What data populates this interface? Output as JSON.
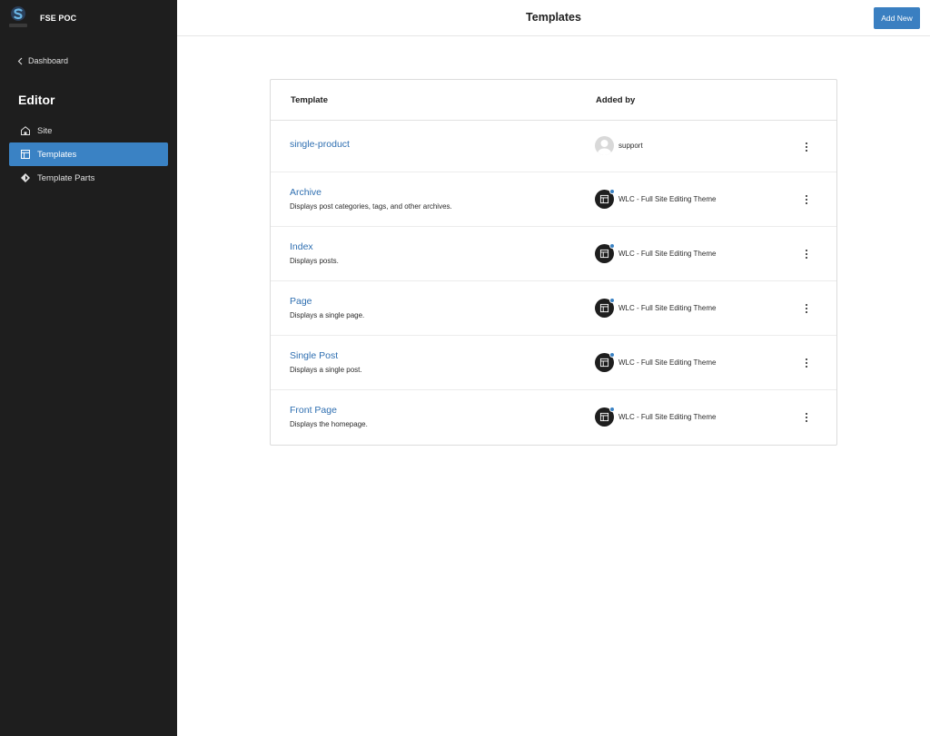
{
  "site": {
    "name": "FSE POC",
    "logo_icon": "site-logo-s-icon"
  },
  "sidebar": {
    "back_label": "Dashboard",
    "editor_title": "Editor",
    "items": [
      {
        "label": "Site",
        "icon": "home-icon",
        "active": false
      },
      {
        "label": "Templates",
        "icon": "layout-icon",
        "active": true
      },
      {
        "label": "Template Parts",
        "icon": "symbol-filled-icon",
        "active": false
      }
    ]
  },
  "header": {
    "title": "Templates",
    "add_new_label": "Add New"
  },
  "table": {
    "columns": {
      "template": "Template",
      "added_by": "Added by"
    },
    "rows": [
      {
        "name": "single-product",
        "description": "",
        "author": "support",
        "author_type": "user"
      },
      {
        "name": "Archive",
        "description": "Displays post categories, tags, and other archives.",
        "author": "WLC - Full Site Editing Theme",
        "author_type": "theme"
      },
      {
        "name": "Index",
        "description": "Displays posts.",
        "author": "WLC - Full Site Editing Theme",
        "author_type": "theme"
      },
      {
        "name": "Page",
        "description": "Displays a single page.",
        "author": "WLC - Full Site Editing Theme",
        "author_type": "theme"
      },
      {
        "name": "Single Post",
        "description": "Displays a single post.",
        "author": "WLC - Full Site Editing Theme",
        "author_type": "theme"
      },
      {
        "name": "Front Page",
        "description": "Displays the homepage.",
        "author": "WLC - Full Site Editing Theme",
        "author_type": "theme"
      }
    ]
  },
  "colors": {
    "sidebar_bg": "#1e1e1e",
    "accent": "#3a82c4",
    "link": "#2f6fb1"
  }
}
